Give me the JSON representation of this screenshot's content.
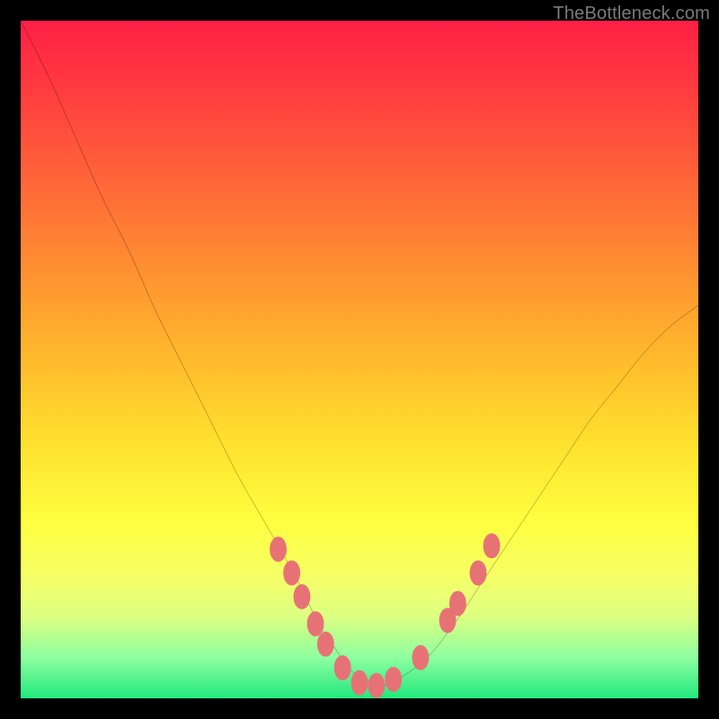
{
  "watermark": "TheBottleneck.com",
  "colors": {
    "frame": "#000000",
    "gradient_top": "#ff1f45",
    "gradient_bottom": "#22e87e",
    "curve": "#000000",
    "dot": "#e77276"
  },
  "chart_data": {
    "type": "line",
    "title": "",
    "xlabel": "",
    "ylabel": "",
    "xlim": [
      0,
      100
    ],
    "ylim": [
      0,
      100
    ],
    "grid": false,
    "legend": false,
    "series": [
      {
        "name": "curve",
        "x": [
          0,
          4,
          8,
          12,
          16,
          20,
          24,
          28,
          32,
          36,
          40,
          44,
          46,
          48,
          50,
          52,
          54,
          56,
          60,
          64,
          68,
          72,
          76,
          80,
          84,
          88,
          92,
          96,
          100
        ],
        "y": [
          100,
          92,
          83,
          74,
          66,
          57,
          49,
          41,
          33,
          26,
          19,
          11,
          8,
          5,
          3,
          2,
          2,
          3,
          6,
          11,
          17,
          23,
          29,
          35,
          41,
          46,
          51,
          55,
          58
        ]
      }
    ],
    "markers": [
      {
        "x": 38.0,
        "y": 22.0
      },
      {
        "x": 40.0,
        "y": 18.5
      },
      {
        "x": 41.5,
        "y": 15.0
      },
      {
        "x": 43.5,
        "y": 11.0
      },
      {
        "x": 45.0,
        "y": 8.0
      },
      {
        "x": 47.5,
        "y": 4.5
      },
      {
        "x": 50.0,
        "y": 2.3
      },
      {
        "x": 52.5,
        "y": 1.9
      },
      {
        "x": 55.0,
        "y": 2.8
      },
      {
        "x": 59.0,
        "y": 6.0
      },
      {
        "x": 63.0,
        "y": 11.5
      },
      {
        "x": 64.5,
        "y": 14.0
      },
      {
        "x": 67.5,
        "y": 18.5
      },
      {
        "x": 69.5,
        "y": 22.5
      }
    ]
  }
}
